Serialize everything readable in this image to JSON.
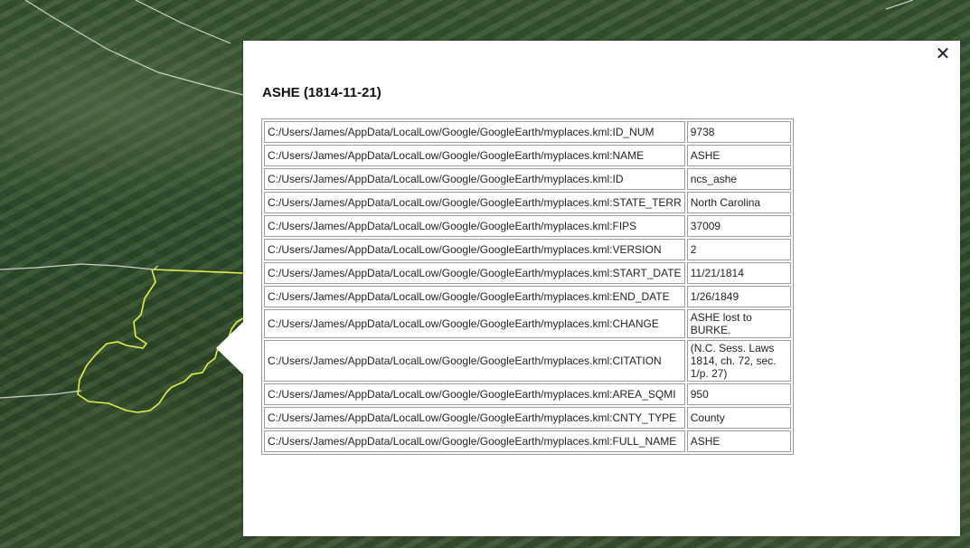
{
  "popup": {
    "title": "ASHE (1814-11-21)",
    "close_icon": "close-icon",
    "close_glyph": "✕",
    "rows": [
      {
        "key": "C:/Users/James/AppData/LocalLow/Google/GoogleEarth/myplaces.kml:ID_NUM",
        "value": "9738"
      },
      {
        "key": "C:/Users/James/AppData/LocalLow/Google/GoogleEarth/myplaces.kml:NAME",
        "value": "ASHE"
      },
      {
        "key": "C:/Users/James/AppData/LocalLow/Google/GoogleEarth/myplaces.kml:ID",
        "value": "ncs_ashe"
      },
      {
        "key": "C:/Users/James/AppData/LocalLow/Google/GoogleEarth/myplaces.kml:STATE_TERR",
        "value": "North Carolina"
      },
      {
        "key": "C:/Users/James/AppData/LocalLow/Google/GoogleEarth/myplaces.kml:FIPS",
        "value": "37009"
      },
      {
        "key": "C:/Users/James/AppData/LocalLow/Google/GoogleEarth/myplaces.kml:VERSION",
        "value": "2"
      },
      {
        "key": "C:/Users/James/AppData/LocalLow/Google/GoogleEarth/myplaces.kml:START_DATE",
        "value": "11/21/1814"
      },
      {
        "key": "C:/Users/James/AppData/LocalLow/Google/GoogleEarth/myplaces.kml:END_DATE",
        "value": "1/26/1849"
      },
      {
        "key": "C:/Users/James/AppData/LocalLow/Google/GoogleEarth/myplaces.kml:CHANGE",
        "value": "ASHE lost to BURKE."
      },
      {
        "key": "C:/Users/James/AppData/LocalLow/Google/GoogleEarth/myplaces.kml:CITATION",
        "value": "(N.C. Sess. Laws 1814, ch. 72, sec. 1/p. 27)"
      },
      {
        "key": "C:/Users/James/AppData/LocalLow/Google/GoogleEarth/myplaces.kml:AREA_SQMI",
        "value": "950"
      },
      {
        "key": "C:/Users/James/AppData/LocalLow/Google/GoogleEarth/myplaces.kml:CNTY_TYPE",
        "value": "County"
      },
      {
        "key": "C:/Users/James/AppData/LocalLow/Google/GoogleEarth/myplaces.kml:FULL_NAME",
        "value": "ASHE"
      }
    ]
  },
  "map": {
    "boundary_color": "#e4f04a",
    "border_line_color": "#c9d2c4"
  }
}
